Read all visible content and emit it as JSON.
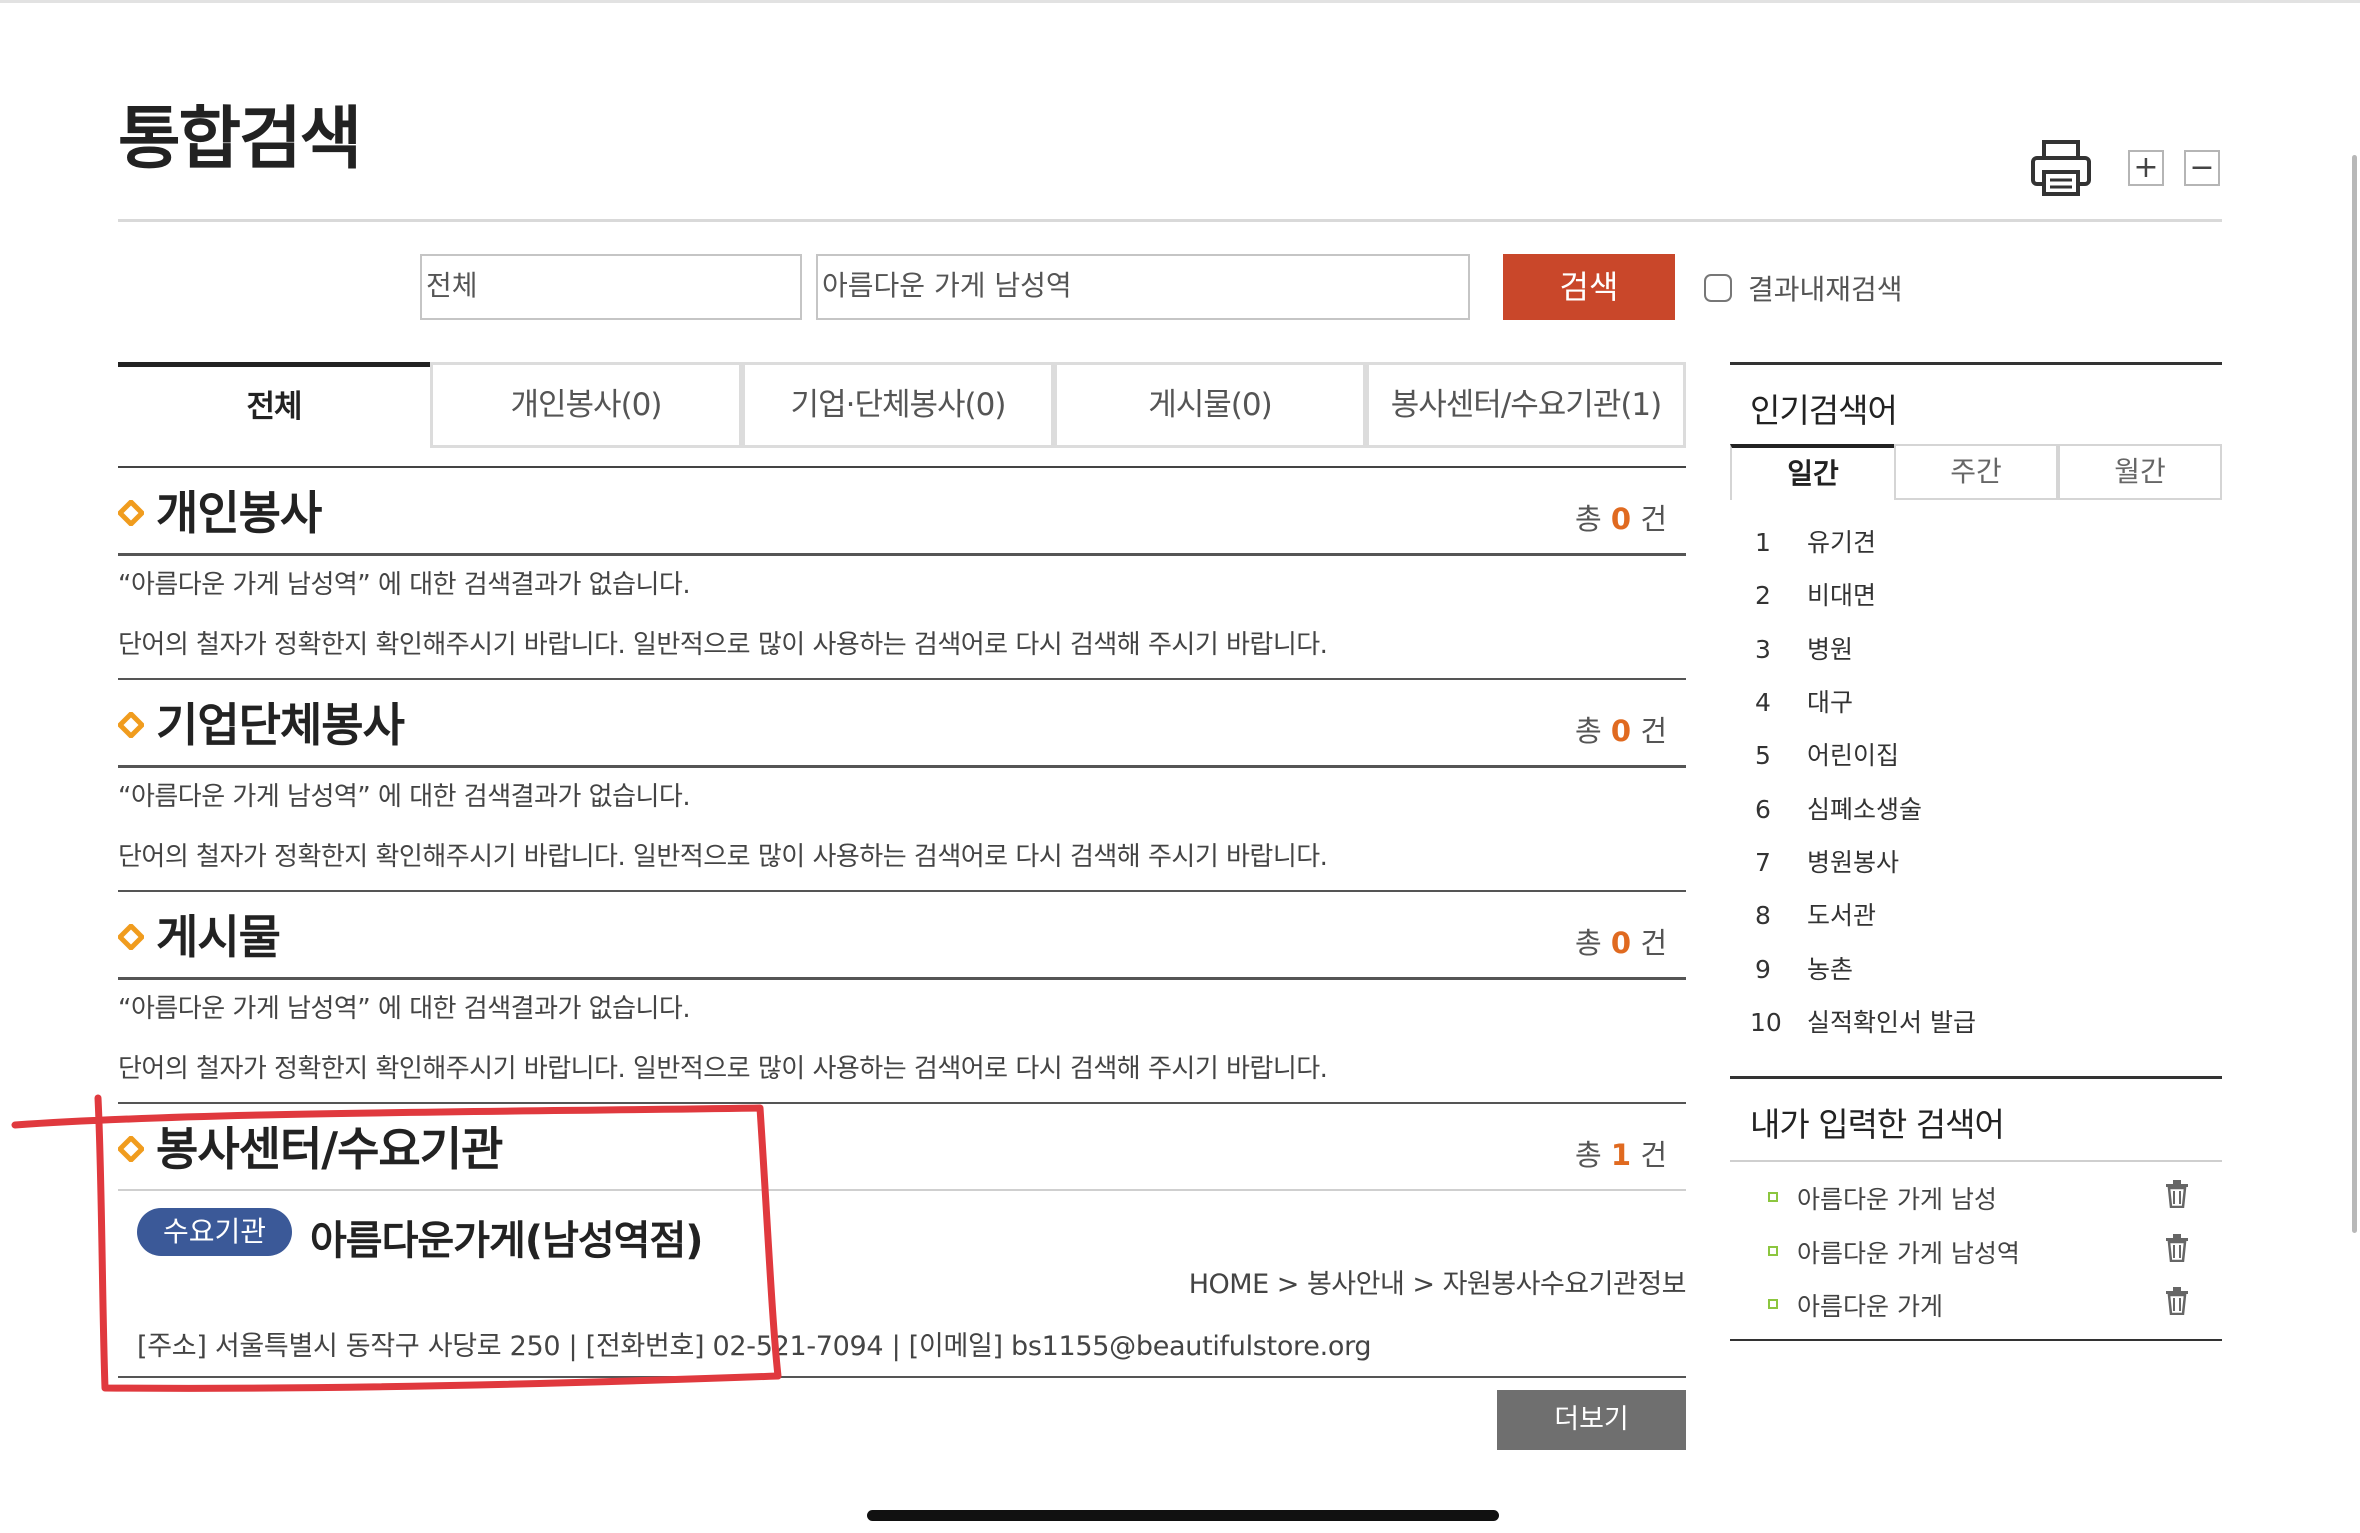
{
  "page": {
    "title": "통합검색"
  },
  "toolbar": {
    "zoom_in": "+",
    "zoom_out": "−"
  },
  "search": {
    "scope_value": "전체",
    "query_value": "아름다운 가게 남성역",
    "button_label": "검색",
    "recheck_label": "결과내재검색"
  },
  "tabs": [
    {
      "label": "전체",
      "active": true
    },
    {
      "label": "개인봉사(0)"
    },
    {
      "label": "기업·단체봉사(0)"
    },
    {
      "label": "게시물(0)"
    },
    {
      "label": "봉사센터/수요기관(1)"
    }
  ],
  "sections": [
    {
      "title": "개인봉사",
      "count_prefix": "총",
      "count": "0",
      "count_suffix": "건",
      "msg1": "“아름다운 가게 남성역” 에 대한 검색결과가 없습니다.",
      "msg2": "단어의 철자가 정확한지 확인해주시기 바랍니다. 일반적으로 많이 사용하는 검색어로 다시 검색해 주시기 바랍니다."
    },
    {
      "title": "기업단체봉사",
      "count_prefix": "총",
      "count": "0",
      "count_suffix": "건",
      "msg1": "“아름다운 가게 남성역” 에 대한 검색결과가 없습니다.",
      "msg2": "단어의 철자가 정확한지 확인해주시기 바랍니다. 일반적으로 많이 사용하는 검색어로 다시 검색해 주시기 바랍니다."
    },
    {
      "title": "게시물",
      "count_prefix": "총",
      "count": "0",
      "count_suffix": "건",
      "msg1": "“아름다운 가게 남성역” 에 대한 검색결과가 없습니다.",
      "msg2": "단어의 철자가 정확한지 확인해주시기 바랍니다. 일반적으로 많이 사용하는 검색어로 다시 검색해 주시기 바랍니다."
    },
    {
      "title": "봉사센터/수요기관",
      "count_prefix": "총",
      "count": "1",
      "count_suffix": "건"
    }
  ],
  "result": {
    "badge": "수요기관",
    "name": "아름다운가게(남성역점)",
    "breadcrumb": "HOME > 봉사안내 > 자원봉사수요기관정보",
    "info": "[주소] 서울특별시 동작구 사당로 250 | [전화번호] 02-521-7094 | [이메일] bs1155@beautifulstore.org"
  },
  "more_button": "더보기",
  "popular": {
    "title": "인기검색어",
    "tabs": [
      {
        "label": "일간",
        "active": true
      },
      {
        "label": "주간"
      },
      {
        "label": "월간"
      }
    ],
    "items": [
      {
        "rank": "1",
        "term": "유기견"
      },
      {
        "rank": "2",
        "term": "비대면"
      },
      {
        "rank": "3",
        "term": "병원"
      },
      {
        "rank": "4",
        "term": "대구"
      },
      {
        "rank": "5",
        "term": "어린이집"
      },
      {
        "rank": "6",
        "term": "심폐소생술"
      },
      {
        "rank": "7",
        "term": "병원봉사"
      },
      {
        "rank": "8",
        "term": "도서관"
      },
      {
        "rank": "9",
        "term": "농촌"
      },
      {
        "rank": "10",
        "term": "실적확인서 발급"
      }
    ]
  },
  "my_searches": {
    "title": "내가 입력한 검색어",
    "items": [
      "아름다운 가게 남성",
      "아름다운 가게 남성역",
      "아름다운 가게"
    ]
  },
  "colors": {
    "accent": "#c9472a",
    "count": "#e06a20",
    "badge": "#3b5998",
    "markup": "#e0393e"
  }
}
